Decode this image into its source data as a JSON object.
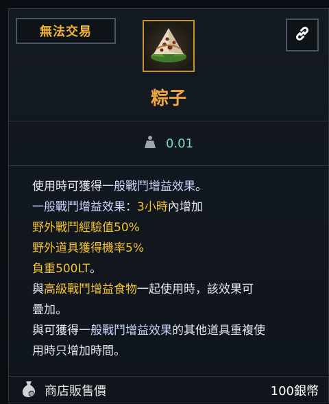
{
  "tooltip": {
    "untradeable_label": "無法交易",
    "item_name": "粽子",
    "weight_value": "0.01",
    "description_lines": [
      [
        {
          "t": "使用時可獲得",
          "c": ""
        },
        {
          "t": "一般戰鬥增益效果",
          "c": "b"
        },
        {
          "t": "。",
          "c": ""
        }
      ],
      [
        {
          "t": "一般戰鬥增益效果",
          "c": "b"
        },
        {
          "t": "：",
          "c": ""
        },
        {
          "t": "3小時",
          "c": "y"
        },
        {
          "t": "內增加",
          "c": ""
        }
      ],
      [
        {
          "t": "野外戰鬥經驗值50%",
          "c": "y"
        }
      ],
      [
        {
          "t": "野外道具獲得機率5%",
          "c": "y"
        }
      ],
      [
        {
          "t": "負重500LT",
          "c": "y"
        },
        {
          "t": "。",
          "c": ""
        }
      ],
      [
        {
          "t": "與",
          "c": ""
        },
        {
          "t": "高級戰鬥增益食物",
          "c": "y"
        },
        {
          "t": "一起使用時，該效果可",
          "c": ""
        }
      ],
      [
        {
          "t": "疊加。",
          "c": ""
        }
      ],
      [
        {
          "t": "與可獲得",
          "c": ""
        },
        {
          "t": "一般戰鬥增益效果",
          "c": "b"
        },
        {
          "t": "的其他道具重複使",
          "c": ""
        }
      ],
      [
        {
          "t": "用時只增加時間。",
          "c": ""
        }
      ]
    ],
    "footer": {
      "price_label": "商店販售價",
      "price_value": "100銀幣"
    }
  },
  "icons": {
    "link": "link-icon",
    "weight": "weight-icon",
    "money_bag": "money-bag-icon",
    "item": "rice-dumpling-icon"
  },
  "colors": {
    "accent_orange": "#f3a73b",
    "highlight_yellow": "#f1c232",
    "highlight_blue": "#c9d6ff",
    "weight_teal": "#7fd8c8",
    "frame_gold": "#c7932f"
  }
}
